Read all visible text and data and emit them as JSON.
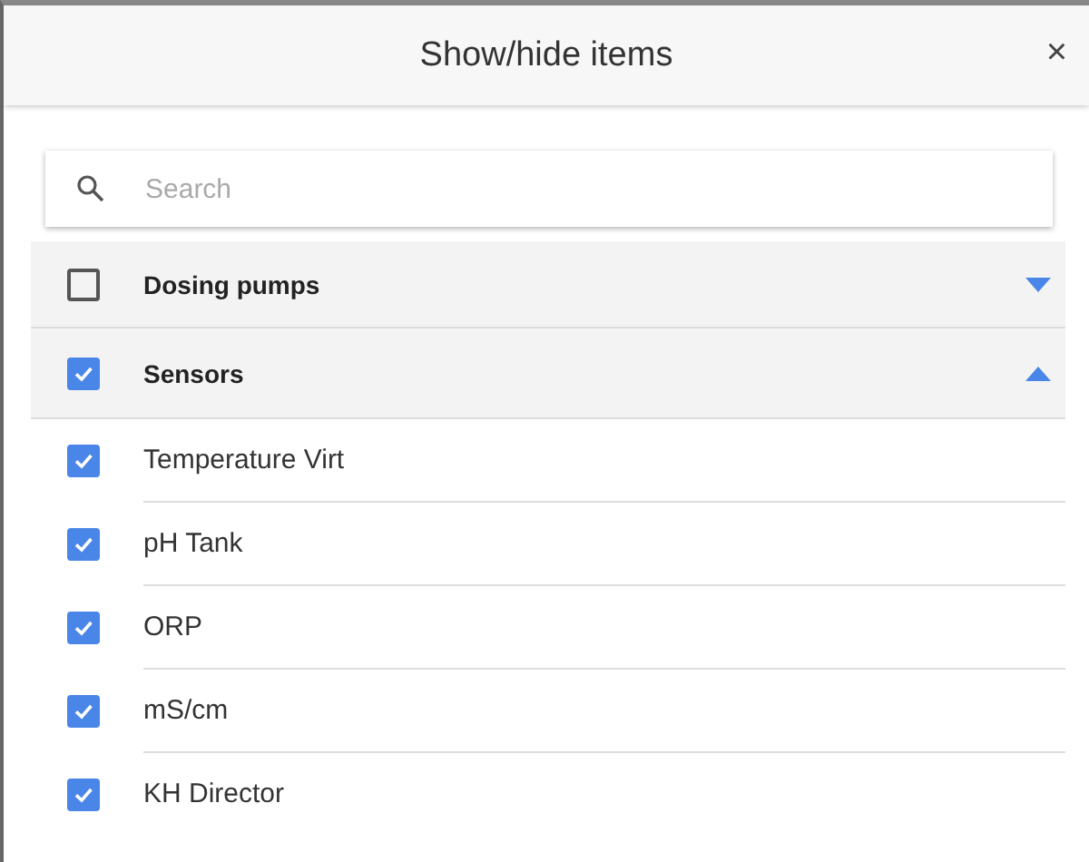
{
  "dialog": {
    "title": "Show/hide items",
    "close": "×"
  },
  "search": {
    "placeholder": "Search"
  },
  "groups": [
    {
      "label": "Dosing pumps",
      "checked": false,
      "expanded": false
    },
    {
      "label": "Sensors",
      "checked": true,
      "expanded": true,
      "items": [
        {
          "label": "Temperature Virt",
          "checked": true
        },
        {
          "label": "pH Tank",
          "checked": true
        },
        {
          "label": "ORP",
          "checked": true
        },
        {
          "label": "mS/cm",
          "checked": true
        },
        {
          "label": "KH Director",
          "checked": true
        }
      ]
    }
  ]
}
